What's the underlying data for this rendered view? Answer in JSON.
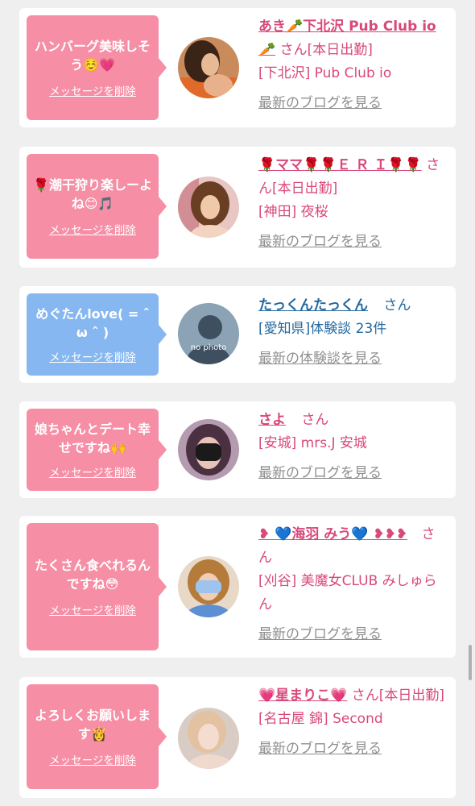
{
  "delete_label": "メッセージを削除",
  "cards": [
    {
      "message": "ハンバーグ美味しそう☺️💗",
      "bubble_color": "#f68ea5",
      "name": "あき🥕下北沢 Pub Club io🥕",
      "san": "さん[本日出勤]",
      "meta": "[下北沢] Pub Club io",
      "link": "最新のブログを見る"
    },
    {
      "message": "🌹潮干狩り楽しーよね😊🎵",
      "bubble_color": "#f68ea5",
      "name": "🌹ママ🌹🌹Ｅ Ｒ Ｉ🌹🌹",
      "san": "さん[本日出勤]",
      "meta": "[神田] 夜桜",
      "link": "最新のブログを見る"
    },
    {
      "message": "めぐたんlove( = ˆ ω ˆ )",
      "bubble_color": "#86b7f0",
      "name": "たっくんたっくん",
      "san": "さん",
      "meta": "[愛知県]体験談 23件",
      "link": "最新の体験談を見る",
      "avatar_text": "no photo"
    },
    {
      "message": "娘ちゃんとデート幸せですね🙌",
      "bubble_color": "#f68ea5",
      "name": "さよ",
      "san": "さん",
      "meta": "[安城] mrs.J 安城",
      "link": "最新のブログを見る"
    },
    {
      "message": "たくさん食べれるんですね😳",
      "bubble_color": "#f68ea5",
      "name": "❥ 💙海羽 みう💙 ❥❥❥",
      "san": "さん",
      "meta": "[刈谷] 美魔女CLUB みしゅらん",
      "link": "最新のブログを見る"
    },
    {
      "message": "よろしくお願いします👸",
      "bubble_color": "#f68ea5",
      "name": "💗星まりこ💗",
      "san": "さん[本日出勤]",
      "meta": "[名古屋 錦] Second",
      "link": "最新のブログを見る"
    }
  ]
}
